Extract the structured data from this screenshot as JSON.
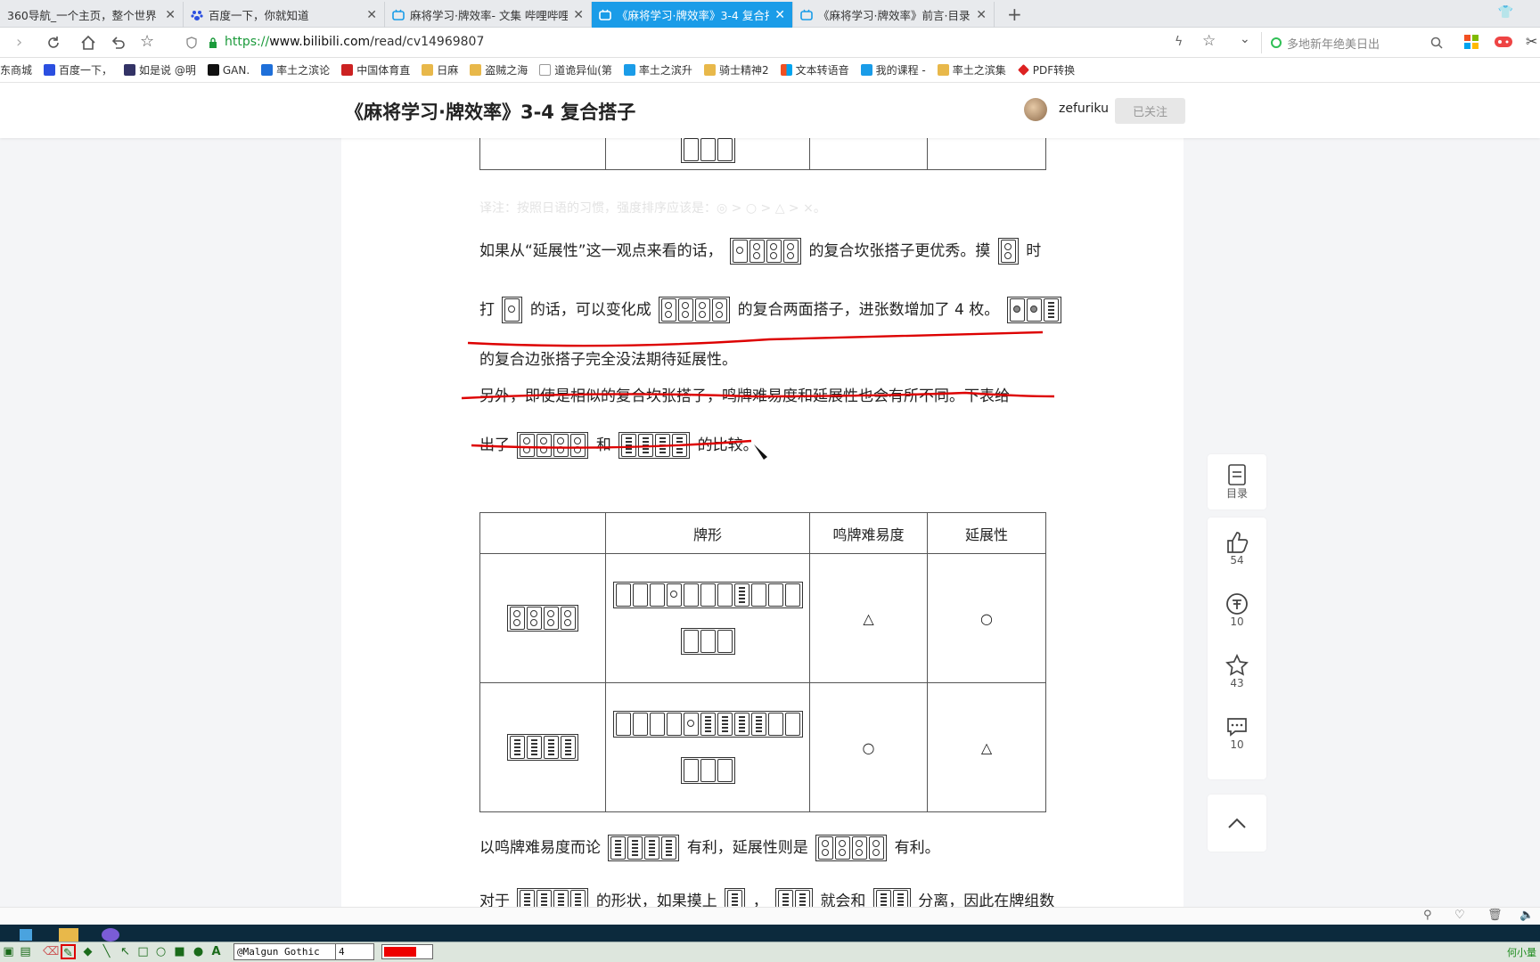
{
  "browser": {
    "tabs": [
      {
        "title": "360导航_一个主页，整个世界",
        "active": false
      },
      {
        "title": "百度一下，你就知道",
        "active": false
      },
      {
        "title": "麻将学习·牌效率- 文集 哔哩哔哩",
        "active": false
      },
      {
        "title": "《麻将学习·牌效率》3-4 复合搭",
        "active": true
      },
      {
        "title": "《麻将学习·牌效率》前言·目录",
        "active": false
      }
    ],
    "new_tab": "+",
    "url_scheme": "https://",
    "url_host": "www.bilibili.com",
    "url_path": "/read/cv14969807",
    "search_placeholder": "多地新年绝美日出"
  },
  "bookmarks": [
    {
      "label": "东商城",
      "color": "#e33"
    },
    {
      "label": "百度一下，",
      "color": "#2b4fe0"
    },
    {
      "label": "如是说 @明",
      "color": "#336"
    },
    {
      "label": "GAN.",
      "color": "#111"
    },
    {
      "label": "率土之滨论",
      "color": "#1e6fd9"
    },
    {
      "label": "中国体育直",
      "color": "#c22"
    },
    {
      "label": "日麻",
      "color": "#e8b84a"
    },
    {
      "label": "盗贼之海",
      "color": "#e8b84a"
    },
    {
      "label": "道诡异仙(第",
      "color": "#999"
    },
    {
      "label": "率土之滨升",
      "color": "#1a9ce8"
    },
    {
      "label": "骑士精神2",
      "color": "#e8b84a"
    },
    {
      "label": "文本转语音",
      "color": "#e44"
    },
    {
      "label": "我的课程 -",
      "color": "#1a9ce8"
    },
    {
      "label": "率土之滨集",
      "color": "#e8b84a"
    },
    {
      "label": "PDF转换",
      "color": "#d22"
    }
  ],
  "article": {
    "title": "《麻将学习·牌效率》3-4 复合搭子",
    "author": "zefuriku",
    "follow_label": "已关注",
    "note": "译注：按照日语的习惯，强度排序应该是：◎ > ○ > △ > ×。",
    "p1_a": "如果从“延展性”这一观点来看的话，",
    "p1_b": "的复合坎张搭子更优秀。摸",
    "p1_c": "时",
    "p2_a": "打",
    "p2_b": "的话，可以变化成",
    "p2_c": "的复合两面搭子，进张数增加了 4 枚。",
    "p3": "的复合边张搭子完全没法期待延展性。",
    "p4": "另外，即使是相似的复合坎张搭子，鸣牌难易度和延展性也会有所不同。下表给",
    "p5_a": "出了",
    "p5_b": "和",
    "p5_c": "的比较。",
    "table": {
      "headers": [
        "",
        "牌形",
        "鸣牌难易度",
        "延展性"
      ],
      "rows": [
        {
          "call": "△",
          "ext": "○"
        },
        {
          "call": "○",
          "ext": "△"
        }
      ]
    },
    "p6_a": "以鸣牌难易度而论",
    "p6_b": "有利，延展性则是",
    "p6_c": "有利。",
    "p7_a": "对于",
    "p7_b": "的形状，如果摸上",
    "p7_c": "，",
    "p7_d": "就会和",
    "p7_e": "分离，因此在牌组数"
  },
  "sidebar": {
    "toc_label": "目录",
    "likes": "54",
    "coins": "10",
    "favorites": "43",
    "comments": "10"
  },
  "drawtool": {
    "font": "@Malgun Gothic",
    "size": "4"
  },
  "taskbar": {
    "user": "何小量"
  }
}
